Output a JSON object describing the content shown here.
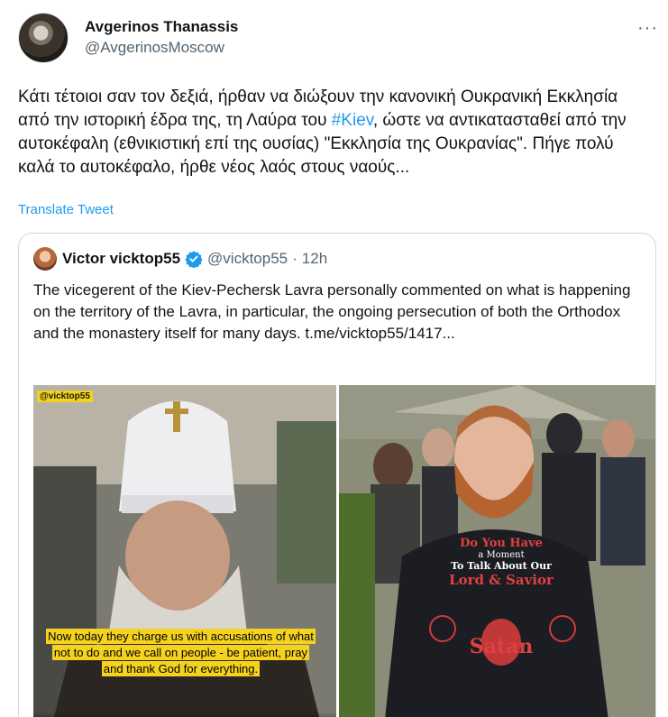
{
  "author": {
    "display_name": "Avgerinos Thanassis",
    "handle": "@AvgerinosMoscow"
  },
  "menu_icon": "more-horizontal-icon",
  "tweet": {
    "text_before": "Κάτι τέτοιοι σαν τον δεξιά, ήρθαν να διώξουν την κανονική Ουκρανική Εκκλησία από την ιστορική έδρα της, τη Λαύρα του ",
    "hashtag": "#Kiev",
    "text_after": ", ώστε να αντικατασταθεί από την αυτοκέφαλη (εθνικιστική επί της ουσίας) \"Εκκλησία της Ουκρανίας\". Πήγε πολύ καλά το αυτοκέφαλο, ήρθε νέος λαός στους ναούς...",
    "translate_label": "Translate Tweet"
  },
  "quoted": {
    "display_name": "Victor vicktop55",
    "handle": "@vicktop55",
    "separator": "·",
    "time": "12h",
    "text": "The vicegerent of the Kiev-Pechersk Lavra personally commented on what is happening on the territory of the Lavra, in particular, the ongoing persecution of both the Orthodox and the monastery itself for many days. t.me/vicktop55/1417...",
    "media": {
      "left_watermark": "@vicktop55",
      "left_caption": "Now today they charge us with accusations of what not to do and we call on people - be patient, pray and thank God for everything.",
      "right_shirt_line1": "Do You Have",
      "right_shirt_line2": "a Moment",
      "right_shirt_line3": "To Talk About Our",
      "right_shirt_line4": "Lord & Savior",
      "right_shirt_line5": "Satan"
    }
  },
  "colors": {
    "link": "#1d9bf0",
    "secondary": "#536471",
    "border": "#cfd9de",
    "caption_bg": "#f5d21f"
  }
}
